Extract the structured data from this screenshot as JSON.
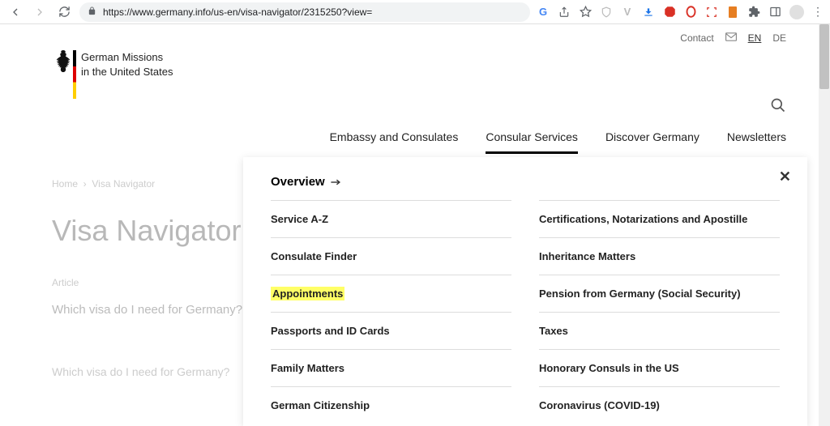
{
  "browser": {
    "url": "https://www.germany.info/us-en/visa-navigator/2315250?view="
  },
  "util": {
    "contact": "Contact",
    "lang_active": "EN",
    "lang_other": "DE"
  },
  "logo": {
    "line1": "German Missions",
    "line2": "in the United States"
  },
  "nav": {
    "items": [
      {
        "label": "Embassy and Consulates"
      },
      {
        "label": "Consular Services",
        "active": true
      },
      {
        "label": "Discover Germany"
      },
      {
        "label": "Newsletters"
      }
    ]
  },
  "bg": {
    "crumb1": "Home",
    "crumb2": "Visa Navigator",
    "title": "Visa Navigator",
    "sub": "Article",
    "q": "Which visa do I need for Germany?",
    "q2": "Which visa do I need for Germany?"
  },
  "dropdown": {
    "overview": "Overview",
    "left": [
      "Service A-Z",
      "Consulate Finder",
      "Appointments",
      "Passports and ID Cards",
      "Family Matters",
      "German Citizenship"
    ],
    "right": [
      "Certifications, Notarizations and Apostille",
      "Inheritance Matters",
      "Pension from Germany (Social Security)",
      "Taxes",
      "Honorary Consuls in the US",
      "Coronavirus (COVID-19)"
    ]
  }
}
